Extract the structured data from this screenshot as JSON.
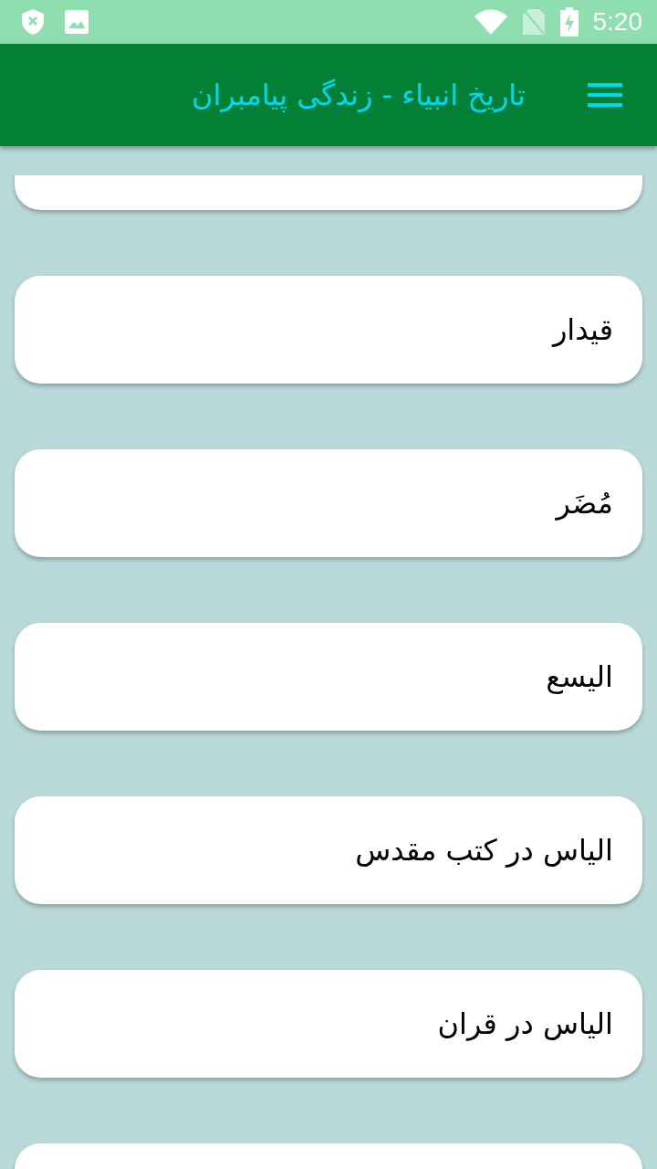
{
  "status_bar": {
    "time": "5:20"
  },
  "app_bar": {
    "title": "تاریخ انبیاء - زندگی پیامبران"
  },
  "items": [
    {
      "title": "قیدار"
    },
    {
      "title": "مُضَر"
    },
    {
      "title": "الیسع"
    },
    {
      "title": "الیاس در کتب مقدس"
    },
    {
      "title": "الیاس در قران"
    }
  ]
}
